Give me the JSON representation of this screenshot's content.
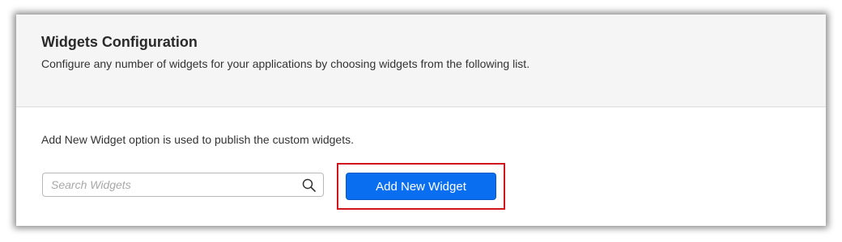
{
  "header": {
    "title": "Widgets Configuration",
    "description": "Configure any number of widgets for your applications by choosing widgets from the following list."
  },
  "content": {
    "note": "Add New Widget option is used to publish the custom widgets.",
    "search": {
      "placeholder": "Search Widgets",
      "value": "",
      "icon": "search-icon"
    },
    "add_button": {
      "label": "Add New Widget"
    }
  },
  "colors": {
    "accent": "#0a6ef0",
    "highlight": "#d0161c",
    "header_background": "#f5f5f5"
  }
}
